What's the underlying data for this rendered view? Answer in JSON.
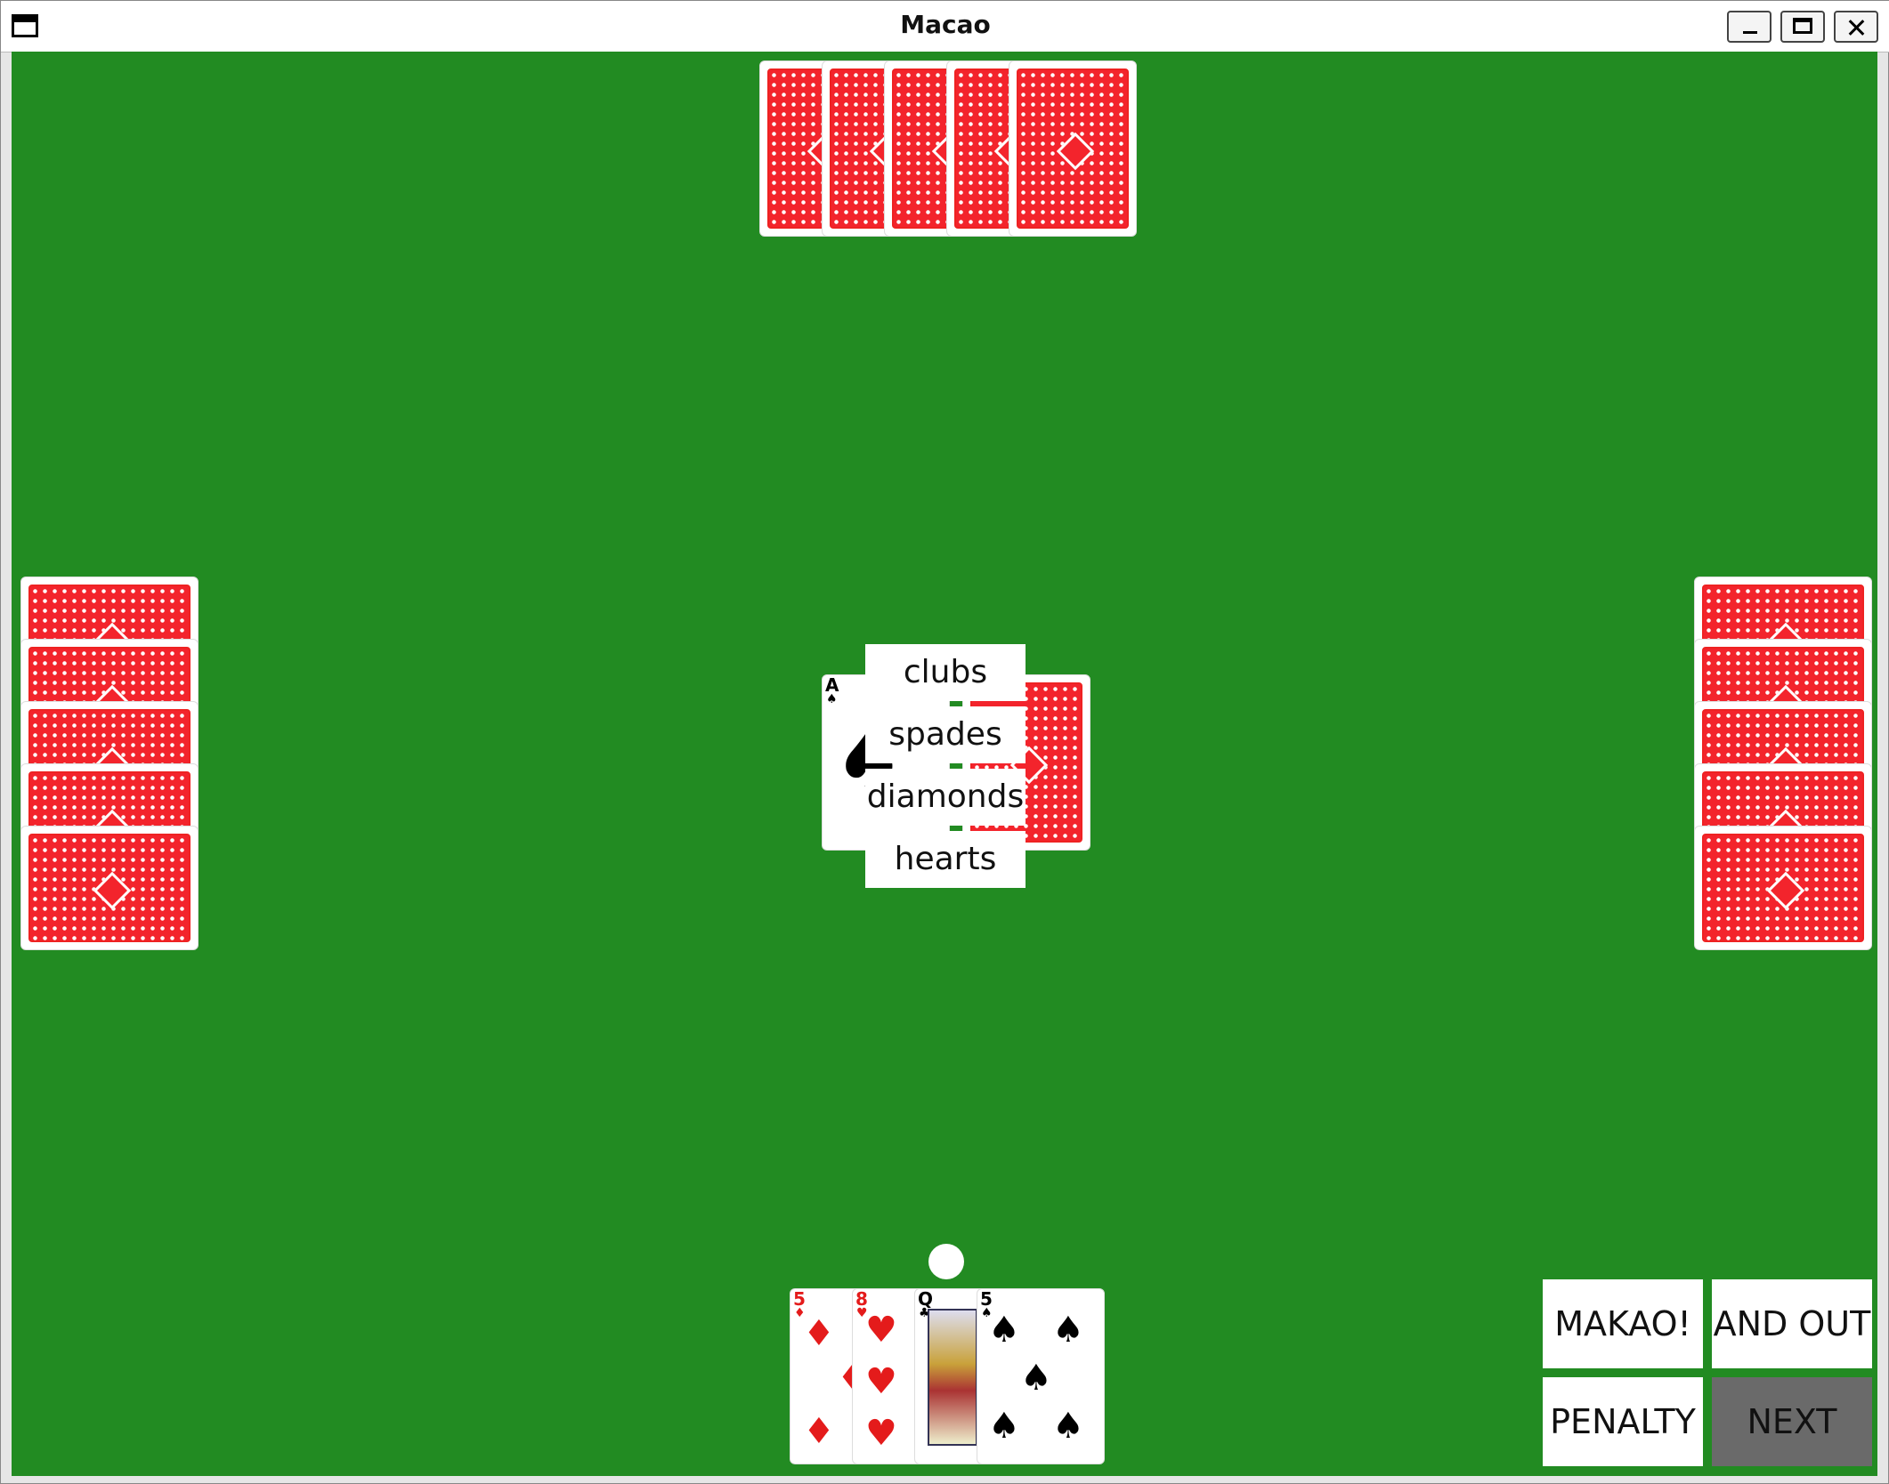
{
  "window": {
    "title": "Macao"
  },
  "colors": {
    "table": "#228b22",
    "card_back": "#f3242c",
    "next_button": "#6a6a6a"
  },
  "opponents": {
    "top": {
      "card_count": 5
    },
    "left": {
      "card_count": 5
    },
    "right": {
      "card_count": 5
    }
  },
  "center": {
    "discard_top": {
      "rank": "A",
      "suit": "♠"
    },
    "draw_pile": "card-back"
  },
  "suit_menu": {
    "options": [
      "clubs",
      "spades",
      "diamonds",
      "hearts"
    ]
  },
  "player_hand": [
    {
      "rank": "5",
      "suit": "♦",
      "color": "red"
    },
    {
      "rank": "8",
      "suit": "♥",
      "color": "red"
    },
    {
      "rank": "Q",
      "suit": "♣",
      "color": "black"
    },
    {
      "rank": "5",
      "suit": "♠",
      "color": "black"
    }
  ],
  "buttons": {
    "makao": "MAKAO!",
    "and_out": "AND OUT",
    "penalty": "PENALTY",
    "next": "NEXT"
  }
}
